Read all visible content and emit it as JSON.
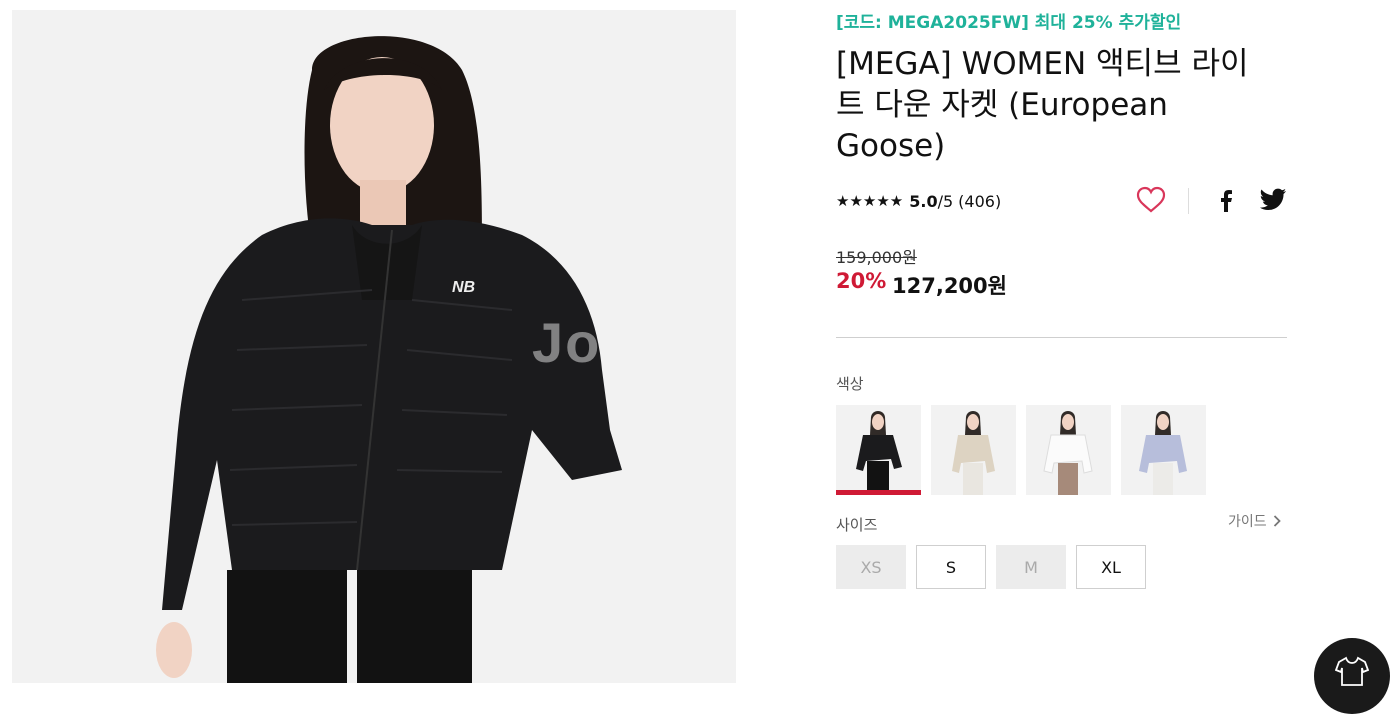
{
  "product": {
    "promo": "[코드: MEGA2025FW] 최대 25% 추가할인",
    "title": "[MEGA] WOMEN 액티브 라이트 다운 자켓 (European Goose)",
    "rating": {
      "stars": "★★★★★",
      "score": "5.0",
      "denom": "/5",
      "count": "(406)"
    },
    "price": {
      "original": "159,000원",
      "discount": "20%",
      "sale": "127,200원"
    },
    "colors": {
      "label": "색상",
      "options": [
        {
          "name": "black",
          "selected": true
        },
        {
          "name": "beige",
          "selected": false
        },
        {
          "name": "white",
          "selected": false
        },
        {
          "name": "lavender",
          "selected": false
        }
      ]
    },
    "sizes": {
      "label": "사이즈",
      "guide": "가이드",
      "options": [
        {
          "label": "XS",
          "available": false
        },
        {
          "label": "S",
          "available": true
        },
        {
          "label": "M",
          "available": false
        },
        {
          "label": "XL",
          "available": true
        }
      ]
    }
  },
  "colors": {
    "promo": "#1fb29a",
    "discount": "#cf1a35",
    "selected_bar": "#cf1a35"
  },
  "icons": {
    "wishlist": "heart-icon",
    "facebook": "facebook-icon",
    "twitter": "twitter-icon",
    "guide_chevron": "chevron-right-icon",
    "fab": "shirt-icon"
  },
  "watermark": "Jo"
}
